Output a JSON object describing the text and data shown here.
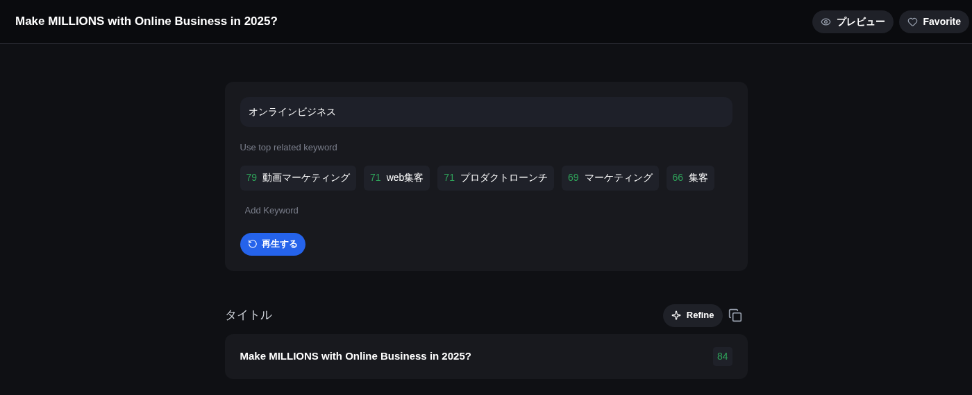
{
  "header": {
    "title": "Make MILLIONS with Online Business in 2025?",
    "buttons": [
      {
        "kind": "preview",
        "label": "プレビュー"
      },
      {
        "kind": "favorite",
        "label": "Favorite"
      }
    ]
  },
  "search": {
    "value": "オンラインビジネス"
  },
  "related": {
    "label": "Use top related keyword",
    "keywords": [
      {
        "score": "79",
        "text": "動画マーケティング"
      },
      {
        "score": "71",
        "text": "web集客"
      },
      {
        "score": "71",
        "text": "プロダクトローンチ"
      },
      {
        "score": "69",
        "text": "マーケティング"
      },
      {
        "score": "66",
        "text": "集客"
      }
    ],
    "add_placeholder": "Add Keyword",
    "regenerate": "再生する"
  },
  "title_section": {
    "heading": "タイトル",
    "refine": "Refine",
    "result": {
      "text": "Make MILLIONS with Online Business in 2025?",
      "score": "84"
    }
  }
}
